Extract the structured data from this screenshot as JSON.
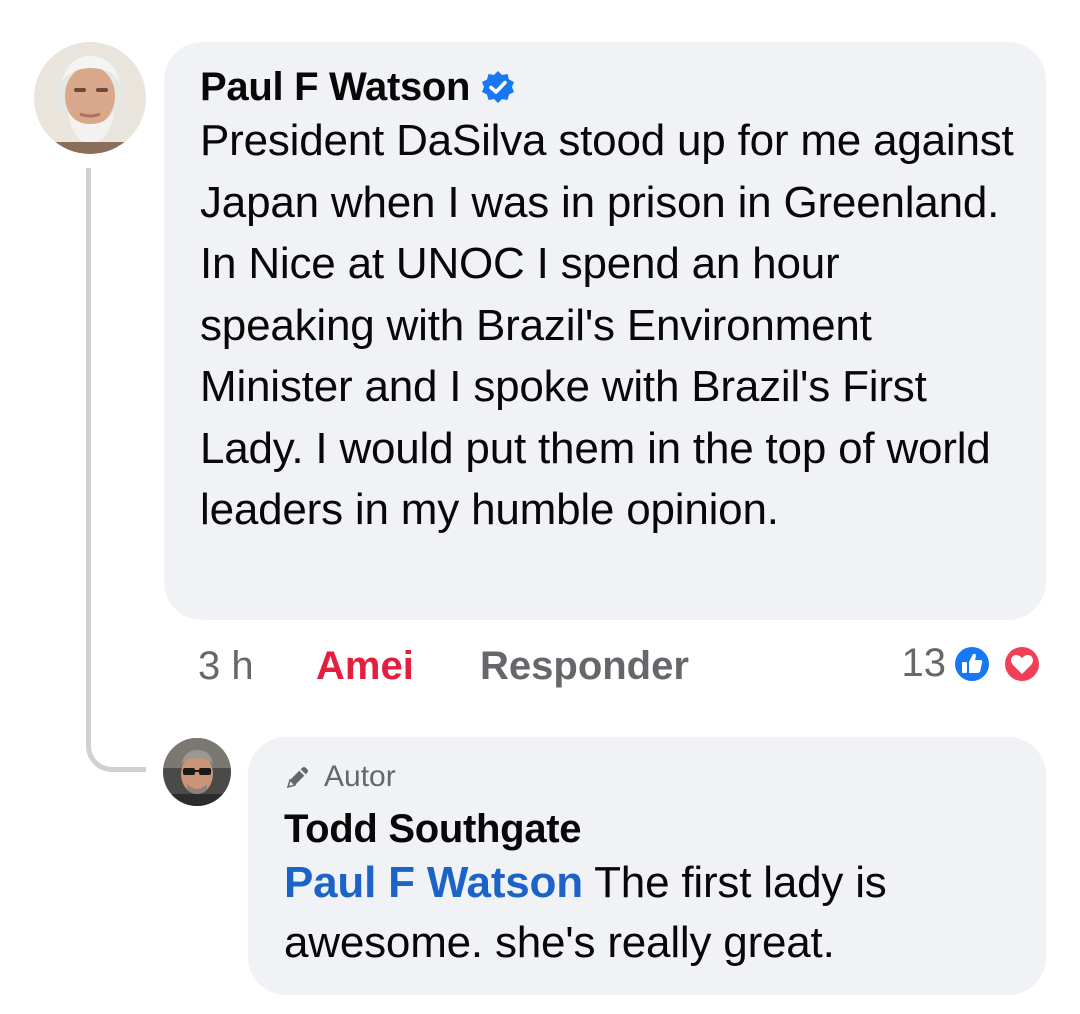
{
  "comment": {
    "author": "Paul F Watson",
    "verified": true,
    "text": "President DaSilva stood up for me against Japan when I was in prison in Greenland. In Nice at UNOC I spend an hour speaking with Brazil's Environment Minister and I spoke with Brazil's First Lady. I would put them in the top of world leaders in my humble opinion.",
    "time": "3 h",
    "love_label": "Amei",
    "reply_label": "Responder",
    "reaction_count": "13",
    "reactions": [
      "like-icon",
      "love-icon"
    ]
  },
  "reply": {
    "badge_label": "Autor",
    "badge_icon": "pencil-icon",
    "author": "Todd Southgate",
    "mention": "Paul F Watson",
    "text": " The first lady is awesome. she's really great."
  },
  "colors": {
    "bubble_bg": "#f0f2f5",
    "mention": "#1c63c8",
    "love": "#e41e3f",
    "secondary_text": "#65676b",
    "like_blue": "#1877f2",
    "love_red": "#f33e58"
  }
}
